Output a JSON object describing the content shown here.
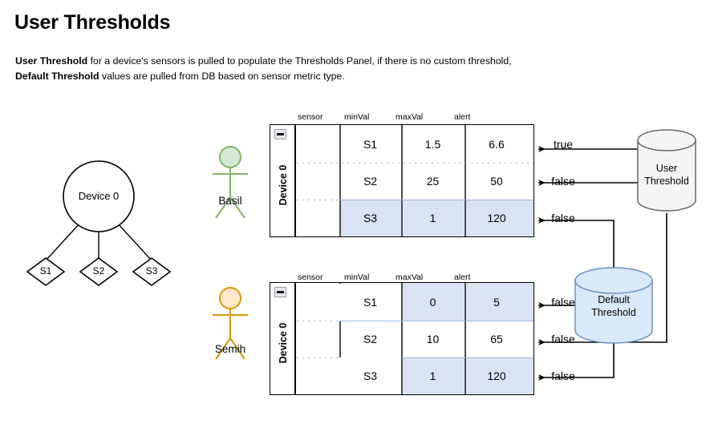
{
  "page": {
    "title": "User Thresholds",
    "intro": {
      "seg1_bold": "User Threshold",
      "seg2": " for a device's sensors is pulled to populate the Thresholds Panel, if there is no custom threshold, ",
      "seg3_bold": "Default Threshold",
      "seg4": " values are pulled from DB based on sensor metric type."
    }
  },
  "device_tree": {
    "root_label": "Device 0",
    "sensors": [
      "S1",
      "S2",
      "S3"
    ]
  },
  "actors": [
    {
      "name": "Basil",
      "color": "#82b366",
      "fill": "#d5e8d4"
    },
    {
      "name": "Semih",
      "color": "#d79b00",
      "fill": "#ffe6cc"
    }
  ],
  "tables": [
    {
      "id": "basil-thresholds",
      "group_label": "Device 0",
      "collapse_icon": "minus-icon",
      "columns": [
        "sensor",
        "minVal",
        "maxVal",
        "alert"
      ],
      "rows": [
        {
          "sensor": "S1",
          "minVal": "1.5",
          "maxVal": "6.6",
          "alert": "true",
          "highlighted": false
        },
        {
          "sensor": "S2",
          "minVal": "25",
          "maxVal": "50",
          "alert": "false",
          "highlighted": false
        },
        {
          "sensor": "S3",
          "minVal": "1",
          "maxVal": "120",
          "alert": "false",
          "highlighted": true
        }
      ]
    },
    {
      "id": "semih-thresholds",
      "group_label": "Device 0",
      "collapse_icon": "minus-icon",
      "columns": [
        "sensor",
        "minVal",
        "maxVal",
        "alert"
      ],
      "rows": [
        {
          "sensor": "S1",
          "minVal": "0",
          "maxVal": "5",
          "alert": "false",
          "highlighted": true
        },
        {
          "sensor": "S2",
          "minVal": "10",
          "maxVal": "65",
          "alert": "false",
          "highlighted": false
        },
        {
          "sensor": "S3",
          "minVal": "1",
          "maxVal": "120",
          "alert": "false",
          "highlighted": true
        }
      ]
    }
  ],
  "databases": [
    {
      "id": "user-threshold-db",
      "line1": "User",
      "line2": "Threshold",
      "fill": "#f5f5f5",
      "stroke": "#666666"
    },
    {
      "id": "default-threshold-db",
      "line1": "Default",
      "line2": "Threshold",
      "fill": "#dae8fc",
      "stroke": "#6c8ebf"
    }
  ],
  "colors": {
    "highlight_row": "#dae3f3",
    "table_border": "#000000",
    "connector": "#000000"
  }
}
